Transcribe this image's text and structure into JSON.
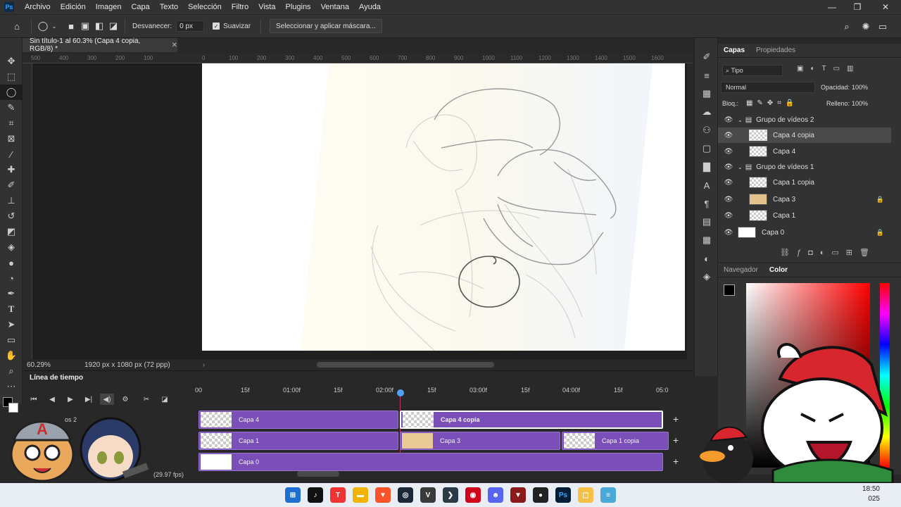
{
  "app": {
    "logo": "Ps"
  },
  "menu": [
    "Archivo",
    "Edición",
    "Imagen",
    "Capa",
    "Texto",
    "Selección",
    "Filtro",
    "Vista",
    "Plugins",
    "Ventana",
    "Ayuda"
  ],
  "options": {
    "feather_label": "Desvanecer:",
    "feather_value": "0 px",
    "smooth_label": "Suavizar",
    "select_mask_button": "Seleccionar y aplicar máscara..."
  },
  "document": {
    "tab_title": "Sin título-1 al 60.3% (Capa 4 copia, RGB/8) *",
    "zoom": "60.29%",
    "size_info": "1920 px x 1080 px (72 ppp)"
  },
  "ruler_labels": [
    "500",
    "400",
    "300",
    "200",
    "100",
    "0",
    "100",
    "200",
    "300",
    "400",
    "500",
    "600",
    "700",
    "800",
    "900",
    "1000",
    "1100",
    "1200",
    "1300",
    "1400",
    "1500",
    "1600"
  ],
  "timeline": {
    "title": "Línea de tiempo",
    "ticks": [
      "00",
      "15f",
      "01:00f",
      "15f",
      "02:00f",
      "15f",
      "03:00f",
      "15f",
      "04:00f",
      "15f",
      "05:0"
    ],
    "fps": "(29.97 fps)",
    "group2_label": "os 2",
    "tracks": [
      {
        "label": "Capa 4"
      },
      {
        "label": "Capa 4 copia"
      },
      {
        "label": "Capa 1"
      },
      {
        "label": "Capa 3"
      },
      {
        "label": "Capa 1 copia"
      },
      {
        "label": "Capa 0"
      }
    ]
  },
  "layers_panel": {
    "tabs": [
      "Capas",
      "Propiedades"
    ],
    "filter": "Tipo",
    "blend_mode": "Normal",
    "opacity_label": "Opacidad:",
    "opacity_value": "100%",
    "lock_label": "Bloq.:",
    "fill_label": "Relleno:",
    "fill_value": "100%",
    "layers": [
      {
        "name": "Grupo de vídeos 2",
        "type": "group"
      },
      {
        "name": "Capa 4 copia",
        "type": "layer",
        "selected": true
      },
      {
        "name": "Capa 4",
        "type": "layer"
      },
      {
        "name": "Grupo de vídeos 1",
        "type": "group"
      },
      {
        "name": "Capa 1 copia",
        "type": "layer"
      },
      {
        "name": "Capa 3",
        "type": "layer",
        "locked": true
      },
      {
        "name": "Capa 1",
        "type": "layer"
      },
      {
        "name": "Capa 0",
        "type": "layer",
        "locked": true
      }
    ]
  },
  "color_panel": {
    "tabs": [
      "Navegador",
      "Color"
    ]
  },
  "taskbar": {
    "time": "18:50",
    "date": "025"
  },
  "colors": {
    "accent": "#7a4fb8",
    "playhead": "#4fa3ff"
  }
}
